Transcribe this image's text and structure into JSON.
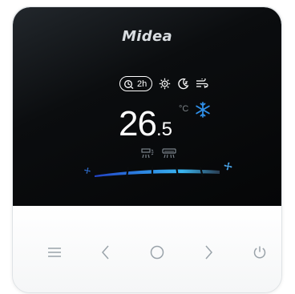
{
  "brand": {
    "logo_text": "Midea"
  },
  "status": {
    "timer_label": "2h",
    "icons": [
      "timer-icon",
      "gear-sun-icon",
      "moon-sleep-icon",
      "wind-swing-icon"
    ]
  },
  "temperature": {
    "integer": "26",
    "decimal": ".5",
    "unit": "°C",
    "mode_icon": "snowflake-icon"
  },
  "fan": {
    "level": 0.6,
    "icons": [
      "fan-low-icon",
      "fan-high-icon"
    ]
  },
  "modes": [
    "vane-swing-icon",
    "ac-unit-icon"
  ],
  "buttons": [
    {
      "name": "menu-button",
      "icon": "hamburger-icon"
    },
    {
      "name": "prev-button",
      "icon": "chevron-left-icon"
    },
    {
      "name": "ok-button",
      "icon": "circle-icon"
    },
    {
      "name": "next-button",
      "icon": "chevron-right-icon"
    },
    {
      "name": "power-button",
      "icon": "power-icon"
    }
  ],
  "colors": {
    "screen": "#050607",
    "accent_blue": "#2f8fe8",
    "icon_grey": "#7b848c"
  }
}
